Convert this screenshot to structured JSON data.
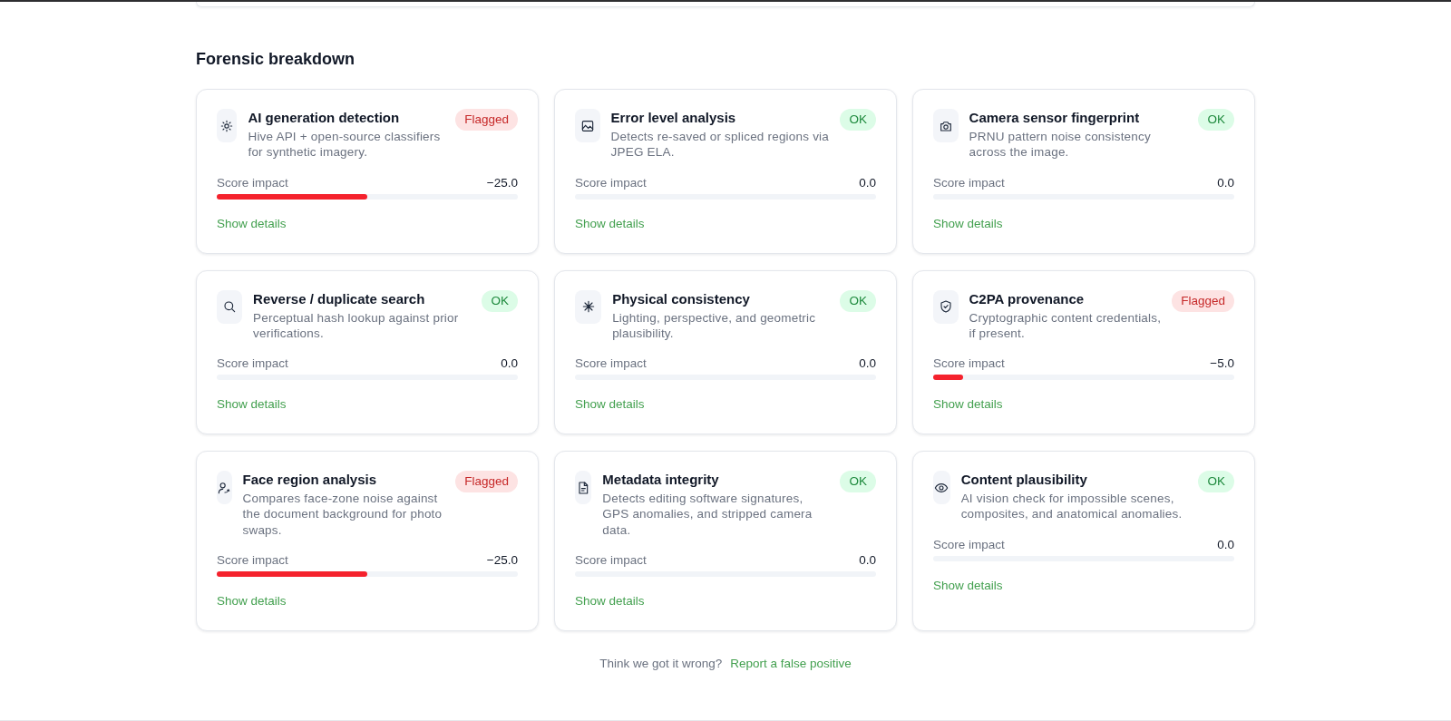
{
  "section": {
    "title": "Forensic breakdown"
  },
  "checks": [
    {
      "title": "AI generation detection",
      "description": "Hive API + open-source classifiers for synthetic imagery.",
      "badge": "Flagged",
      "flagged": true,
      "score_label": "Score impact",
      "score": "−25.0",
      "level": 0.5,
      "details_link": "Show details"
    },
    {
      "title": "Error level analysis",
      "description": "Detects re-saved or spliced regions via JPEG ELA.",
      "badge": "OK",
      "flagged": false,
      "score_label": "Score impact",
      "score": "0.0",
      "level": 0,
      "details_link": "Show details"
    },
    {
      "title": "Camera sensor fingerprint",
      "description": "PRNU pattern noise consistency across the image.",
      "badge": "OK",
      "flagged": false,
      "score_label": "Score impact",
      "score": "0.0",
      "level": 0,
      "details_link": "Show details"
    },
    {
      "title": "Reverse / duplicate search",
      "description": "Perceptual hash lookup against prior verifications.",
      "badge": "OK",
      "flagged": false,
      "score_label": "Score impact",
      "score": "0.0",
      "level": 0,
      "details_link": "Show details"
    },
    {
      "title": "Physical consistency",
      "description": "Lighting, perspective, and geometric plausibility.",
      "badge": "OK",
      "flagged": false,
      "score_label": "Score impact",
      "score": "0.0",
      "level": 0,
      "details_link": "Show details"
    },
    {
      "title": "C2PA provenance",
      "description": "Cryptographic content credentials, if present.",
      "badge": "Flagged",
      "flagged": true,
      "score_label": "Score impact",
      "score": "−5.0",
      "level": 0.1,
      "details_link": "Show details"
    },
    {
      "title": "Face region analysis",
      "description": "Compares face-zone noise against the document background for photo swaps.",
      "badge": "Flagged",
      "flagged": true,
      "score_label": "Score impact",
      "score": "−25.0",
      "level": 0.5,
      "details_link": "Show details"
    },
    {
      "title": "Metadata integrity",
      "description": "Detects editing software signatures, GPS anomalies, and stripped camera data.",
      "badge": "OK",
      "flagged": false,
      "score_label": "Score impact",
      "score": "0.0",
      "level": 0,
      "details_link": "Show details"
    },
    {
      "title": "Content plausibility",
      "description": "AI vision check for impossible scenes, composites, and anatomical anomalies.",
      "badge": "OK",
      "flagged": false,
      "score_label": "Score impact",
      "score": "0.0",
      "level": 0,
      "details_link": "Show details"
    }
  ],
  "footer": {
    "text": "Think we got it wrong?",
    "link": "Report a false positive"
  }
}
